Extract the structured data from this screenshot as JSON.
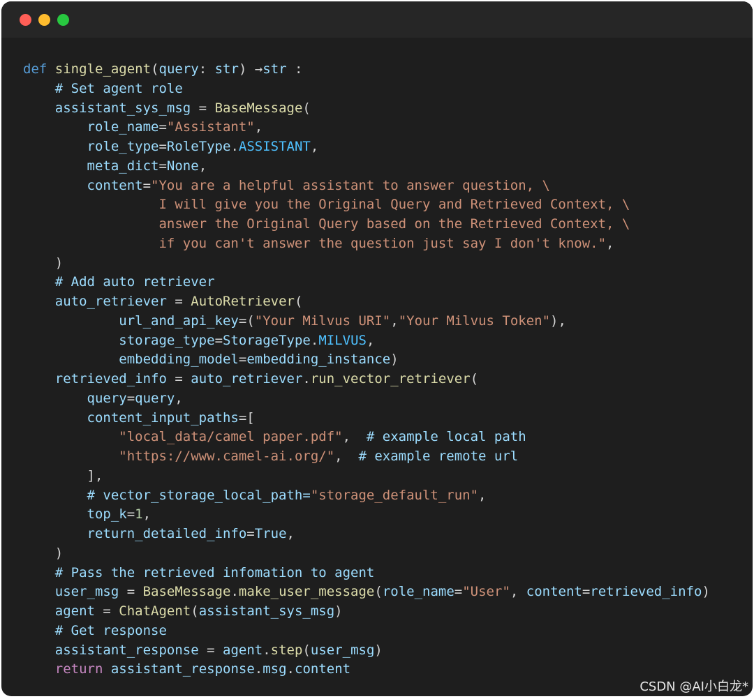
{
  "window": {
    "buttons": [
      "close",
      "minimize",
      "maximize"
    ]
  },
  "code_lines": [
    [
      [
        "k",
        "def"
      ],
      [
        "t",
        " "
      ],
      [
        "f",
        "single_agent"
      ],
      [
        "t",
        "("
      ],
      [
        "v",
        "query"
      ],
      [
        "t",
        ": "
      ],
      [
        "v",
        "str"
      ],
      [
        "t",
        ") →"
      ],
      [
        "v",
        "str"
      ],
      [
        "t",
        " :"
      ]
    ],
    [
      [
        "t",
        "    "
      ],
      [
        "cm",
        "# Set agent role"
      ]
    ],
    [
      [
        "t",
        "    "
      ],
      [
        "v",
        "assistant_sys_msg"
      ],
      [
        "t",
        " = "
      ],
      [
        "f",
        "BaseMessage"
      ],
      [
        "t",
        "("
      ]
    ],
    [
      [
        "t",
        "        "
      ],
      [
        "v",
        "role_name"
      ],
      [
        "t",
        "="
      ],
      [
        "s",
        "\"Assistant\""
      ],
      [
        "t",
        ","
      ]
    ],
    [
      [
        "t",
        "        "
      ],
      [
        "v",
        "role_type"
      ],
      [
        "t",
        "="
      ],
      [
        "v",
        "RoleType"
      ],
      [
        "t",
        "."
      ],
      [
        "cst",
        "ASSISTANT"
      ],
      [
        "t",
        ","
      ]
    ],
    [
      [
        "t",
        "        "
      ],
      [
        "v",
        "meta_dict"
      ],
      [
        "t",
        "="
      ],
      [
        "v",
        "None"
      ],
      [
        "t",
        ","
      ]
    ],
    [
      [
        "t",
        "        "
      ],
      [
        "v",
        "content"
      ],
      [
        "t",
        "="
      ],
      [
        "s",
        "\"You are a helpful assistant to answer question, \\"
      ]
    ],
    [
      [
        "s",
        "                 I will give you the Original Query and Retrieved Context, \\"
      ]
    ],
    [
      [
        "s",
        "                 answer the Original Query based on the Retrieved Context, \\"
      ]
    ],
    [
      [
        "s",
        "                 if you can't answer the question just say I don't know.\""
      ],
      [
        "t",
        ","
      ]
    ],
    [
      [
        "t",
        "    )"
      ]
    ],
    [
      [
        "t",
        "    "
      ],
      [
        "cm",
        "# Add auto retriever"
      ]
    ],
    [
      [
        "t",
        "    "
      ],
      [
        "v",
        "auto_retriever"
      ],
      [
        "t",
        " = "
      ],
      [
        "f",
        "AutoRetriever"
      ],
      [
        "t",
        "("
      ]
    ],
    [
      [
        "t",
        "            "
      ],
      [
        "v",
        "url_and_api_key"
      ],
      [
        "t",
        "=("
      ],
      [
        "s",
        "\"Your Milvus URI\""
      ],
      [
        "t",
        ","
      ],
      [
        "s",
        "\"Your Milvus Token\""
      ],
      [
        "t",
        "),"
      ]
    ],
    [
      [
        "t",
        "            "
      ],
      [
        "v",
        "storage_type"
      ],
      [
        "t",
        "="
      ],
      [
        "v",
        "StorageType"
      ],
      [
        "t",
        "."
      ],
      [
        "cst",
        "MILVUS"
      ],
      [
        "t",
        ","
      ]
    ],
    [
      [
        "t",
        "            "
      ],
      [
        "v",
        "embedding_model"
      ],
      [
        "t",
        "="
      ],
      [
        "v",
        "embedding_instance"
      ],
      [
        "t",
        ")"
      ]
    ],
    [
      [
        "t",
        "    "
      ],
      [
        "v",
        "retrieved_info"
      ],
      [
        "t",
        " = "
      ],
      [
        "v",
        "auto_retriever"
      ],
      [
        "t",
        "."
      ],
      [
        "f",
        "run_vector_retriever"
      ],
      [
        "t",
        "("
      ]
    ],
    [
      [
        "t",
        "        "
      ],
      [
        "v",
        "query"
      ],
      [
        "t",
        "="
      ],
      [
        "v",
        "query"
      ],
      [
        "t",
        ","
      ]
    ],
    [
      [
        "t",
        "        "
      ],
      [
        "v",
        "content_input_paths"
      ],
      [
        "t",
        "=["
      ]
    ],
    [
      [
        "t",
        "            "
      ],
      [
        "s",
        "\"local_data/camel paper.pdf\""
      ],
      [
        "t",
        ",  "
      ],
      [
        "cm",
        "# example local path"
      ]
    ],
    [
      [
        "t",
        "            "
      ],
      [
        "s",
        "\"https://www.camel-ai.org/\""
      ],
      [
        "t",
        ",  "
      ],
      [
        "cm",
        "# example remote url"
      ]
    ],
    [
      [
        "t",
        "        ],"
      ]
    ],
    [
      [
        "t",
        "        "
      ],
      [
        "cm",
        "# vector_storage_local_path="
      ],
      [
        "s",
        "\"storage_default_run\""
      ],
      [
        "t",
        ","
      ]
    ],
    [
      [
        "t",
        "        "
      ],
      [
        "v",
        "top_k"
      ],
      [
        "t",
        "="
      ],
      [
        "n",
        "1"
      ],
      [
        "t",
        ","
      ]
    ],
    [
      [
        "t",
        "        "
      ],
      [
        "v",
        "return_detailed_info"
      ],
      [
        "t",
        "="
      ],
      [
        "v",
        "True"
      ],
      [
        "t",
        ","
      ]
    ],
    [
      [
        "t",
        "    )"
      ]
    ],
    [
      [
        "t",
        "    "
      ],
      [
        "cm",
        "# Pass the retrieved infomation to agent"
      ]
    ],
    [
      [
        "t",
        "    "
      ],
      [
        "v",
        "user_msg"
      ],
      [
        "t",
        " = "
      ],
      [
        "f",
        "BaseMessage"
      ],
      [
        "t",
        "."
      ],
      [
        "f",
        "make_user_message"
      ],
      [
        "t",
        "("
      ],
      [
        "v",
        "role_name"
      ],
      [
        "t",
        "="
      ],
      [
        "s",
        "\"User\""
      ],
      [
        "t",
        ", "
      ],
      [
        "v",
        "content"
      ],
      [
        "t",
        "="
      ],
      [
        "v",
        "retrieved_info"
      ],
      [
        "t",
        ")"
      ]
    ],
    [
      [
        "t",
        "    "
      ],
      [
        "v",
        "agent"
      ],
      [
        "t",
        " = "
      ],
      [
        "f",
        "ChatAgent"
      ],
      [
        "t",
        "("
      ],
      [
        "v",
        "assistant_sys_msg"
      ],
      [
        "t",
        ")"
      ]
    ],
    [
      [
        "t",
        "    "
      ],
      [
        "cm",
        "# Get response"
      ]
    ],
    [
      [
        "t",
        "    "
      ],
      [
        "v",
        "assistant_response"
      ],
      [
        "t",
        " = "
      ],
      [
        "v",
        "agent"
      ],
      [
        "t",
        "."
      ],
      [
        "f",
        "step"
      ],
      [
        "t",
        "("
      ],
      [
        "v",
        "user_msg"
      ],
      [
        "t",
        ")"
      ]
    ],
    [
      [
        "t",
        "    "
      ],
      [
        "r",
        "return"
      ],
      [
        "t",
        " "
      ],
      [
        "v",
        "assistant_response"
      ],
      [
        "t",
        "."
      ],
      [
        "v",
        "msg"
      ],
      [
        "t",
        "."
      ],
      [
        "v",
        "content"
      ]
    ]
  ],
  "watermark": "CSDN @AI小白龙*"
}
